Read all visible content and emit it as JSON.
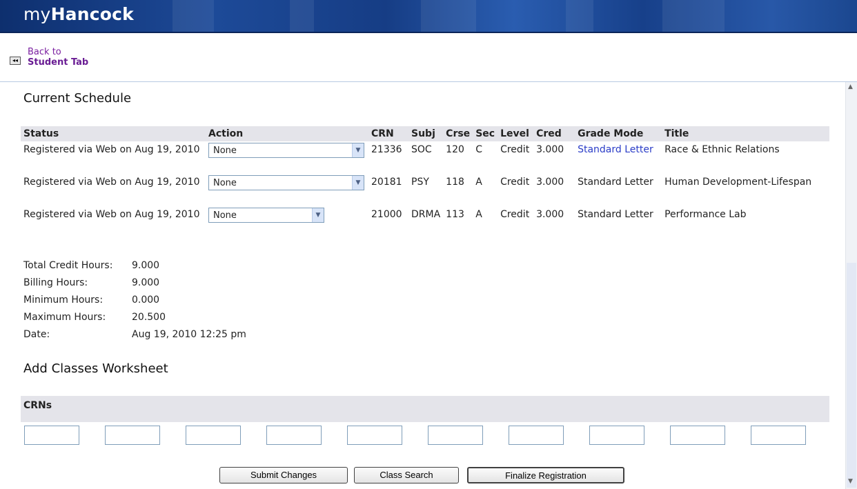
{
  "header": {
    "brand_prefix": "my",
    "brand_name": "Hancock"
  },
  "nav": {
    "back_line1": "Back to",
    "back_line2": "Student Tab"
  },
  "schedule": {
    "heading": "Current Schedule",
    "columns": [
      "Status",
      "Action",
      "CRN",
      "Subj",
      "Crse",
      "Sec",
      "Level",
      "Cred",
      "Grade Mode",
      "Title"
    ],
    "rows": [
      {
        "status": "Registered via Web on Aug 19, 2010",
        "action": "None",
        "crn": "21336",
        "subj": "SOC",
        "crse": "120",
        "sec": "C",
        "level": "Credit",
        "cred": "3.000",
        "grade_mode": "Standard Letter",
        "title": "Race & Ethnic Relations"
      },
      {
        "status": "Registered via Web on Aug 19, 2010",
        "action": "None",
        "crn": "20181",
        "subj": "PSY",
        "crse": "118",
        "sec": "A",
        "level": "Credit",
        "cred": "3.000",
        "grade_mode": "Standard Letter",
        "title": "Human Development-Lifespan"
      },
      {
        "status": "Registered via Web on Aug 19, 2010",
        "action": "None",
        "crn": "21000",
        "subj": "DRMA",
        "crse": "113",
        "sec": "A",
        "level": "Credit",
        "cred": "3.000",
        "grade_mode": "Standard Letter",
        "title": "Performance Lab"
      }
    ]
  },
  "totals": [
    {
      "label": "Total Credit Hours:",
      "value": "9.000"
    },
    {
      "label": "Billing Hours:",
      "value": "9.000"
    },
    {
      "label": "Minimum Hours:",
      "value": "0.000"
    },
    {
      "label": "Maximum Hours:",
      "value": "20.500"
    },
    {
      "label": "Date:",
      "value": "Aug 19, 2010 12:25 pm"
    }
  ],
  "worksheet": {
    "heading": "Add Classes Worksheet",
    "crns_label": "CRNs",
    "crn_values": [
      "",
      "",
      "",
      "",
      "",
      "",
      "",
      "",
      "",
      ""
    ]
  },
  "buttons": {
    "submit": "Submit Changes",
    "search": "Class Search",
    "finalize": "Finalize Registration"
  },
  "colors": {
    "header_blue": "#1d4a98",
    "link_blue": "#2a3cc7",
    "back_link_purple": "#7a1fa0",
    "table_header_bg": "#e4e4ea"
  },
  "icons": {
    "back": "back-arrow-icon",
    "dropdown": "chevron-down-icon",
    "scroll_up": "scroll-up-arrow-icon",
    "scroll_down": "scroll-down-arrow-icon"
  }
}
